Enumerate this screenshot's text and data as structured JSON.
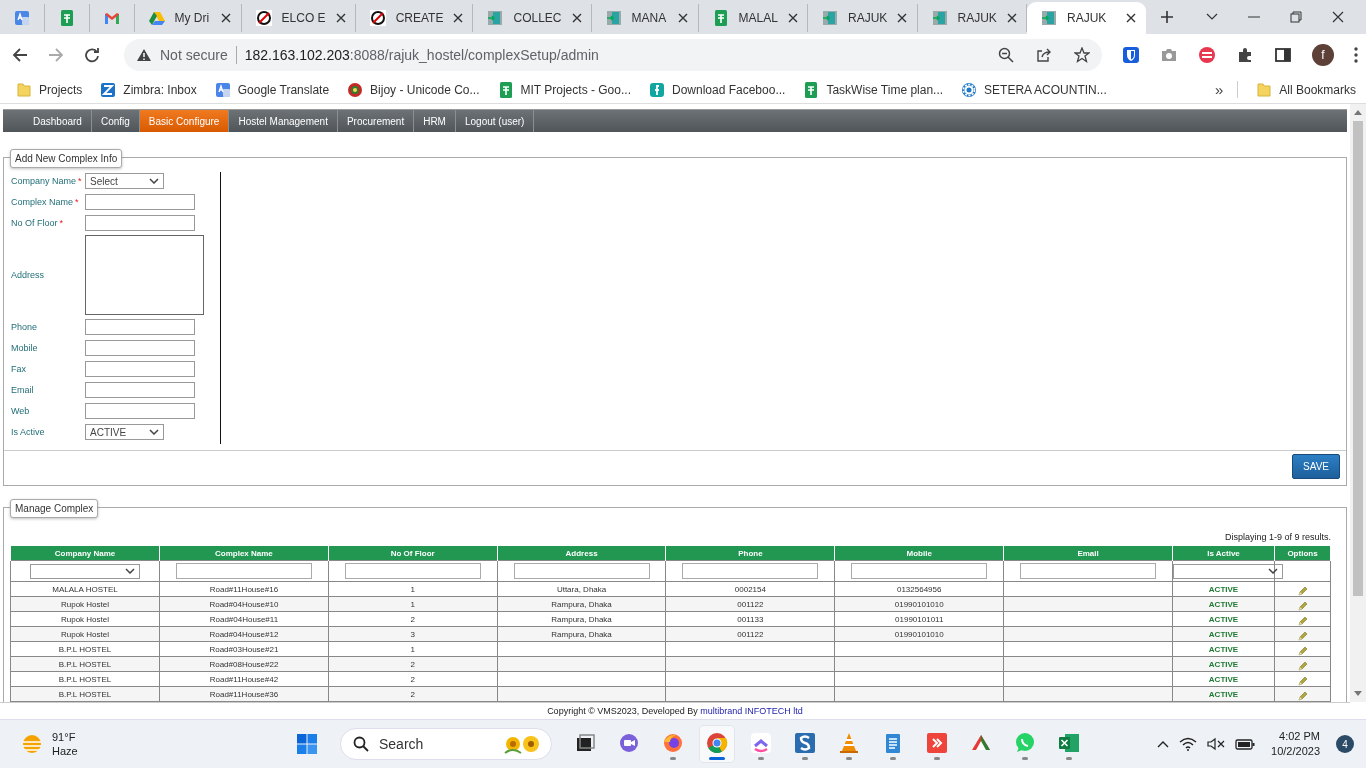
{
  "browser": {
    "tabs": [
      {
        "kind": "translate",
        "selected": false
      },
      {
        "kind": "sheet",
        "selected": false
      },
      {
        "kind": "mail",
        "selected": false
      },
      {
        "kind": "drive",
        "title": "My Dri",
        "selected": false
      },
      {
        "kind": "slash",
        "title": "ELCO E",
        "selected": false
      },
      {
        "kind": "slash",
        "title": "CREATE",
        "selected": false
      },
      {
        "kind": "door",
        "title": "COLLEC",
        "selected": false
      },
      {
        "kind": "door",
        "title": "MANA",
        "selected": false
      },
      {
        "kind": "sheet",
        "title": "MALAL",
        "selected": false
      },
      {
        "kind": "door",
        "title": "RAJUK",
        "selected": false
      },
      {
        "kind": "door",
        "title": "RAJUK",
        "selected": false
      },
      {
        "kind": "door",
        "title": "RAJUK",
        "selected": true
      }
    ],
    "address": {
      "security": "Not secure",
      "host": "182.163.102.203",
      "path": ":8088/rajuk_hostel/complexSetup/admin"
    },
    "profile": "f",
    "bookmarks": [
      {
        "kind": "folder",
        "label": "Projects"
      },
      {
        "kind": "letter",
        "label": "Zimbra: Inbox"
      },
      {
        "kind": "translate",
        "label": "Google Translate"
      },
      {
        "kind": "seal",
        "label": "Bijoy - Unicode Co..."
      },
      {
        "kind": "sheet",
        "label": "MIT Projects - Goo..."
      },
      {
        "kind": "teal",
        "label": "Download Faceboo..."
      },
      {
        "kind": "sheet",
        "label": "TaskWise Time plan..."
      },
      {
        "kind": "gear",
        "label": "SETERA ACOUNTIN..."
      }
    ],
    "more": "»",
    "all_bookmarks": "All Bookmarks"
  },
  "nav": [
    {
      "label": "Dashboard",
      "selected": false
    },
    {
      "label": "Config",
      "selected": false
    },
    {
      "label": "Basic Configure",
      "selected": true
    },
    {
      "label": "Hostel Management",
      "selected": false
    },
    {
      "label": "Procurement",
      "selected": false
    },
    {
      "label": "HRM",
      "selected": false
    },
    {
      "label": "Logout (user)",
      "selected": false
    }
  ],
  "form": {
    "legend": "Add New Complex Info",
    "fields": [
      {
        "kind": "select",
        "label": "Company Name",
        "required_mark": "*",
        "value": "Select"
      },
      {
        "kind": "text",
        "label": "Complex Name",
        "required_mark": "*"
      },
      {
        "kind": "text",
        "label": "No Of Floor",
        "required_mark": "*"
      },
      {
        "kind": "textarea",
        "label": "Address"
      },
      {
        "kind": "text",
        "label": "Phone"
      },
      {
        "kind": "text",
        "label": "Mobile"
      },
      {
        "kind": "text",
        "label": "Fax"
      },
      {
        "kind": "text",
        "label": "Email"
      },
      {
        "kind": "text",
        "label": "Web"
      },
      {
        "kind": "select",
        "label": "Is Active",
        "value": "ACTIVE"
      }
    ],
    "save": "SAVE"
  },
  "manage": {
    "legend": "Manage Complex",
    "summary": "Displaying 1-9 of 9 results.",
    "columns": [
      {
        "label": "Company Name",
        "kind": "dropdown"
      },
      {
        "label": "Complex Name",
        "kind": "field"
      },
      {
        "label": "No Of Floor",
        "kind": "field"
      },
      {
        "label": "Address",
        "kind": "field"
      },
      {
        "label": "Phone",
        "kind": "field"
      },
      {
        "label": "Mobile",
        "kind": "field"
      },
      {
        "label": "Email",
        "kind": "field"
      },
      {
        "label": "Is Active",
        "kind": "dropdown"
      },
      {
        "label": "Options",
        "kind": "actions"
      }
    ],
    "rows": [
      {
        "cells": [
          "MALALA HOSTEL",
          "Road#11House#16",
          "1",
          "Uttara, Dhaka",
          "0002154",
          "0132564956",
          "",
          "ACTIVE"
        ]
      },
      {
        "cells": [
          "Rupok Hostel",
          "Road#04House#10",
          "1",
          "Rampura, Dhaka",
          "001122",
          "01990101010",
          "",
          "ACTIVE"
        ]
      },
      {
        "cells": [
          "Rupok Hostel",
          "Road#04House#11",
          "2",
          "Rampura, Dhaka",
          "001133",
          "01990101011",
          "",
          "ACTIVE"
        ]
      },
      {
        "cells": [
          "Rupok Hostel",
          "Road#04House#12",
          "3",
          "Rampura, Dhaka",
          "001122",
          "01990101010",
          "",
          "ACTIVE"
        ]
      },
      {
        "cells": [
          "B.P.L HOSTEL",
          "Road#03House#21",
          "1",
          "",
          "",
          "",
          "",
          "ACTIVE"
        ]
      },
      {
        "cells": [
          "B.P.L HOSTEL",
          "Road#08House#22",
          "2",
          "",
          "",
          "",
          "",
          "ACTIVE"
        ]
      },
      {
        "cells": [
          "B.P.L HOSTEL",
          "Road#11House#42",
          "2",
          "",
          "",
          "",
          "",
          "ACTIVE"
        ]
      },
      {
        "cells": [
          "B.P.L HOSTEL",
          "Road#11House#36",
          "2",
          "",
          "",
          "",
          "",
          "ACTIVE"
        ]
      }
    ]
  },
  "footer": {
    "text": "Copyright © VMS2023, Developed By",
    "link": "multibrand INFOTECH ltd"
  },
  "taskbar": {
    "temperature": "91°F",
    "condition": "Haze",
    "search": "Search",
    "apps": [
      {
        "kind": "taskview",
        "running": false,
        "active": false
      },
      {
        "kind": "chat",
        "running": false,
        "active": false
      },
      {
        "kind": "firefox",
        "running": true,
        "active": false
      },
      {
        "kind": "chrome",
        "running": true,
        "active": true
      },
      {
        "kind": "tasks",
        "running": true,
        "active": false
      },
      {
        "kind": "sapp",
        "running": true,
        "active": false
      },
      {
        "kind": "cone",
        "running": true,
        "active": false
      },
      {
        "kind": "notepad",
        "running": true,
        "active": false
      },
      {
        "kind": "remote",
        "running": true,
        "active": false
      },
      {
        "kind": "pie",
        "running": false,
        "active": false
      },
      {
        "kind": "whatsapp",
        "running": true,
        "active": false
      },
      {
        "kind": "excel",
        "running": true,
        "active": false
      }
    ],
    "time": "4:02 PM",
    "date": "10/2/2023",
    "badge": "4"
  }
}
